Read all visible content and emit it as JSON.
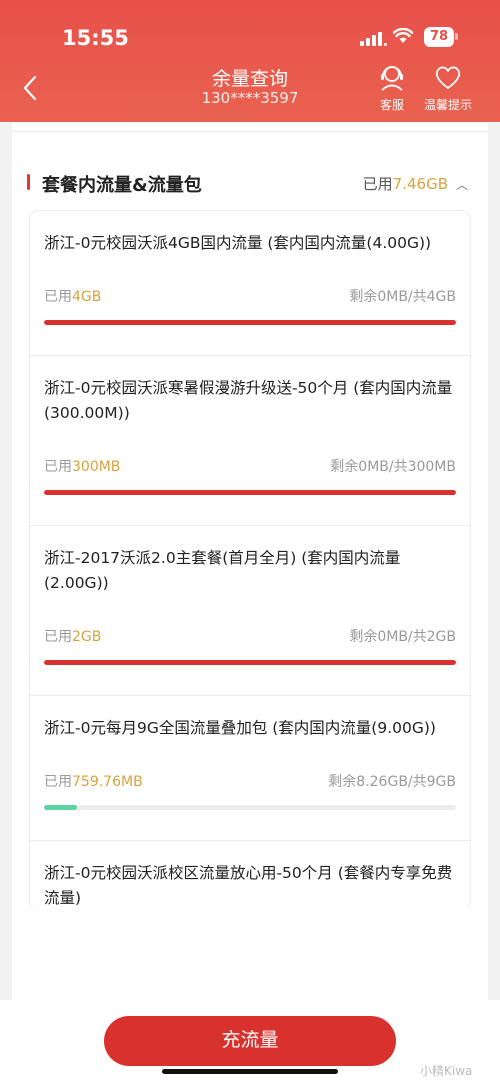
{
  "status": {
    "time": "15:55",
    "battery": "78"
  },
  "nav": {
    "title": "余量查询",
    "subtitle": "130****3597",
    "service_label": "客服",
    "tips_label": "温馨提示"
  },
  "section": {
    "title": "套餐内流量&流量包",
    "used_prefix": "已用",
    "used_amount": "7.46GB"
  },
  "colors": {
    "accent": "#e8504a",
    "used": "#d9a23c",
    "full_bar": "#d9322e",
    "partial_bar": "#5fd1a6"
  },
  "items": [
    {
      "title": "浙江-0元校园沃派4GB国内流量 (套内国内流量(4.00G))",
      "used_prefix": "已用",
      "used": "4GB",
      "remain": "剩余0MB/共4GB",
      "progress": 1.0
    },
    {
      "title": "浙江-0元校园沃派寒暑假漫游升级送-50个月 (套内国内流量(300.00M))",
      "used_prefix": "已用",
      "used": "300MB",
      "remain": "剩余0MB/共300MB",
      "progress": 1.0
    },
    {
      "title": "浙江-2017沃派2.0主套餐(首月全月) (套内国内流量(2.00G))",
      "used_prefix": "已用",
      "used": "2GB",
      "remain": "剩余0MB/共2GB",
      "progress": 1.0
    },
    {
      "title": "浙江-0元每月9G全国流量叠加包 (套内国内流量(9.00G))",
      "used_prefix": "已用",
      "used": "759.76MB",
      "remain": "剩余8.26GB/共9GB",
      "progress": 0.08
    },
    {
      "title": "浙江-0元校园沃派校区流量放心用-50个月 (套餐内专享免费流量)"
    }
  ],
  "bottom": {
    "button_label": "充流量",
    "watermark": "小精Kiwa"
  }
}
